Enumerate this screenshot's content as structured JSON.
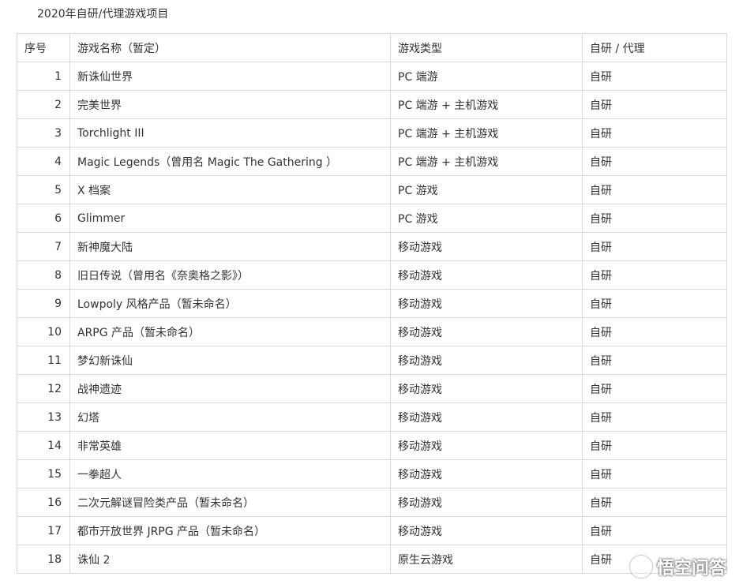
{
  "title": "2020年自研/代理游戏项目",
  "table": {
    "headers": [
      "序号",
      "游戏名称（暂定）",
      "游戏类型",
      "自研 / 代理"
    ],
    "rows": [
      [
        "1",
        "新诛仙世界",
        "PC 端游",
        "自研"
      ],
      [
        "2",
        "完美世界",
        "PC 端游 + 主机游戏",
        "自研"
      ],
      [
        "3",
        "Torchlight III",
        "PC 端游 + 主机游戏",
        "自研"
      ],
      [
        "4",
        "Magic Legends（曾用名 Magic The Gathering ）",
        "PC 端游 + 主机游戏",
        "自研"
      ],
      [
        "5",
        "X 档案",
        "PC 游戏",
        "自研"
      ],
      [
        "6",
        "Glimmer",
        "PC 游戏",
        "自研"
      ],
      [
        "7",
        "新神魔大陆",
        "移动游戏",
        "自研"
      ],
      [
        "8",
        "旧日传说（曾用名《奈奥格之影》）",
        "移动游戏",
        "自研"
      ],
      [
        "9",
        "Lowpoly 风格产品（暂未命名）",
        "移动游戏",
        "自研"
      ],
      [
        "10",
        "ARPG 产品（暂未命名）",
        "移动游戏",
        "自研"
      ],
      [
        "11",
        "梦幻新诛仙",
        "移动游戏",
        "自研"
      ],
      [
        "12",
        "战神遗迹",
        "移动游戏",
        "自研"
      ],
      [
        "13",
        "幻塔",
        "移动游戏",
        "自研"
      ],
      [
        "14",
        "非常英雄",
        "移动游戏",
        "自研"
      ],
      [
        "15",
        "一拳超人",
        "移动游戏",
        "自研"
      ],
      [
        "16",
        "二次元解谜冒险类产品（暂未命名）",
        "移动游戏",
        "自研"
      ],
      [
        "17",
        "都市开放世界 JRPG 产品（暂未命名）",
        "移动游戏",
        "自研"
      ],
      [
        "18",
        "诛仙 2",
        "原生云游戏",
        "自研"
      ]
    ]
  },
  "watermark": {
    "text": "悟空问答",
    "icon": "chat-bubble-icon"
  }
}
